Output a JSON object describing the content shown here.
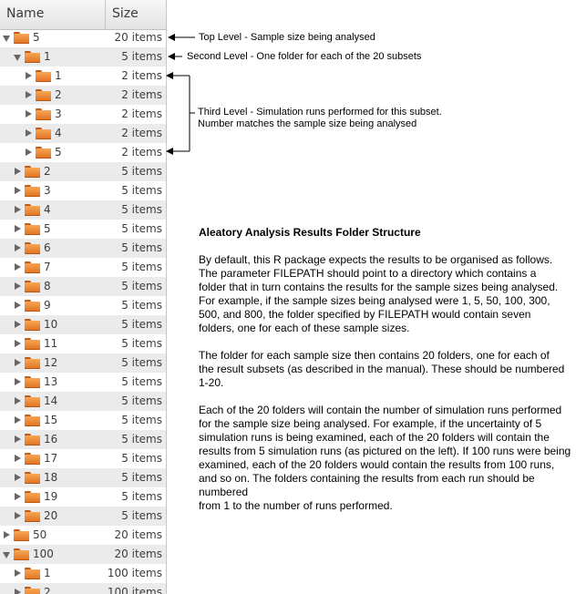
{
  "header": {
    "name_label": "Name",
    "size_label": "Size"
  },
  "tree": [
    {
      "name": "5",
      "size": "20 items",
      "depth": 0,
      "expanded": true
    },
    {
      "name": "1",
      "size": "5 items",
      "depth": 1,
      "expanded": true
    },
    {
      "name": "1",
      "size": "2 items",
      "depth": 2,
      "expanded": false
    },
    {
      "name": "2",
      "size": "2 items",
      "depth": 2,
      "expanded": false
    },
    {
      "name": "3",
      "size": "2 items",
      "depth": 2,
      "expanded": false
    },
    {
      "name": "4",
      "size": "2 items",
      "depth": 2,
      "expanded": false
    },
    {
      "name": "5",
      "size": "2 items",
      "depth": 2,
      "expanded": false
    },
    {
      "name": "2",
      "size": "5 items",
      "depth": 1,
      "expanded": false
    },
    {
      "name": "3",
      "size": "5 items",
      "depth": 1,
      "expanded": false
    },
    {
      "name": "4",
      "size": "5 items",
      "depth": 1,
      "expanded": false
    },
    {
      "name": "5",
      "size": "5 items",
      "depth": 1,
      "expanded": false
    },
    {
      "name": "6",
      "size": "5 items",
      "depth": 1,
      "expanded": false
    },
    {
      "name": "7",
      "size": "5 items",
      "depth": 1,
      "expanded": false
    },
    {
      "name": "8",
      "size": "5 items",
      "depth": 1,
      "expanded": false
    },
    {
      "name": "9",
      "size": "5 items",
      "depth": 1,
      "expanded": false
    },
    {
      "name": "10",
      "size": "5 items",
      "depth": 1,
      "expanded": false
    },
    {
      "name": "11",
      "size": "5 items",
      "depth": 1,
      "expanded": false
    },
    {
      "name": "12",
      "size": "5 items",
      "depth": 1,
      "expanded": false
    },
    {
      "name": "13",
      "size": "5 items",
      "depth": 1,
      "expanded": false
    },
    {
      "name": "14",
      "size": "5 items",
      "depth": 1,
      "expanded": false
    },
    {
      "name": "15",
      "size": "5 items",
      "depth": 1,
      "expanded": false
    },
    {
      "name": "16",
      "size": "5 items",
      "depth": 1,
      "expanded": false
    },
    {
      "name": "17",
      "size": "5 items",
      "depth": 1,
      "expanded": false
    },
    {
      "name": "18",
      "size": "5 items",
      "depth": 1,
      "expanded": false
    },
    {
      "name": "19",
      "size": "5 items",
      "depth": 1,
      "expanded": false
    },
    {
      "name": "20",
      "size": "5 items",
      "depth": 1,
      "expanded": false
    },
    {
      "name": "50",
      "size": "20 items",
      "depth": 0,
      "expanded": false
    },
    {
      "name": "100",
      "size": "20 items",
      "depth": 0,
      "expanded": true
    },
    {
      "name": "1",
      "size": "100 items",
      "depth": 1,
      "expanded": false
    },
    {
      "name": "2",
      "size": "100 items",
      "depth": 1,
      "expanded": false
    }
  ],
  "annotations": {
    "top_level": "Top Level - Sample size being analysed",
    "second_level": "Second Level - One folder for each of the 20 subsets",
    "third_level_line1": "Third Level - Simulation runs performed for this subset.",
    "third_level_line2": "Number matches the sample size being analysed"
  },
  "info": {
    "title": "Aleatory Analysis Results Folder Structure",
    "paragraph1": "By default, this R package expects the results to be organised as follows.\nThe parameter FILEPATH should point to a directory which contains a\nfolder that in turn contains the results for the sample sizes being analysed.\nFor example, if the sample sizes being analysed were 1, 5, 50, 100, 300,\n500, and 800, the folder specified by FILEPATH would contain seven\nfolders, one for each of these sample sizes.",
    "paragraph2": "The folder for each sample size then contains 20 folders, one for each of\nthe result subsets (as described in the manual).  These should be numbered\n1-20.",
    "paragraph3": "Each of the 20 folders will contain the number of simulation runs performed\nfor the sample size being analysed.  For example, if the uncertainty of 5\nsimulation runs is being examined, each of the 20 folders will contain the\nresults from 5 simulation runs (as pictured on the left).  If 100 runs were being\nexamined, each of the 20 folders would contain the results from 100 runs,\nand so on.  The folders containing the results from each run should be numbered\nfrom 1 to the number of runs performed."
  },
  "colors": {
    "folder": "#e9822e",
    "row_alt": "#ebebeb",
    "text": "#3c3c3c"
  },
  "icons": {
    "folder": "folder-icon",
    "expander": "expander-triangle-icon"
  }
}
